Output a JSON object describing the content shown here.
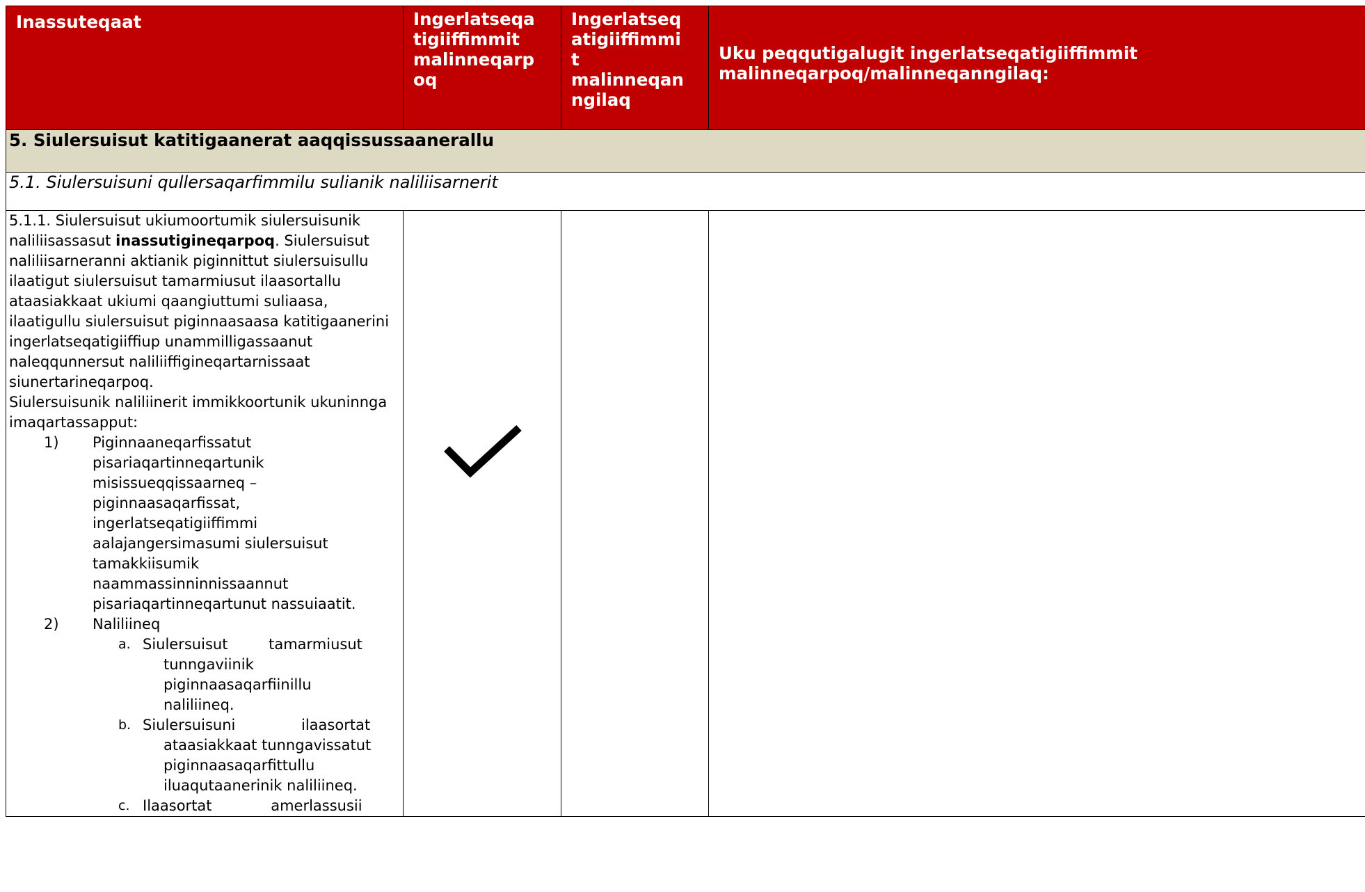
{
  "header": {
    "col1": "Inassuteqaat",
    "col2": "Ingerlatseqatigiiffimmit malinneqarpoq",
    "col2_lines": [
      "Ingerlatseqa",
      "tigiiffimmit",
      "malinneqarp",
      "oq"
    ],
    "col3_lines": [
      "Ingerlatseq",
      "atigiiffimmi",
      "t",
      "malinneqan",
      "ngilaq"
    ],
    "col4": "Uku peqqutigalugit ingerlatseqatigiiffimmit malinneqarpoq/malinneqanngilaq:"
  },
  "section": {
    "title": "5. Siulersuisut katitigaanerat aaqqissussaanerallu"
  },
  "subsection": {
    "title": "5.1. Siulersuisuni qullersaqarfimmilu sulianik naliliisarnerit"
  },
  "item": {
    "intro_before_bold": "5.1.1. Siulersuisut ukiumoortumik siulersuisunik naliliisassasut",
    "bold": "inassutigineqarpoq",
    "intro_after_bold": ". Siulersuisut naliliisarneranni aktianik piginnittut siulersuisullu ilaatigut siulersuisut tamarmiusut ilaasortallu ataasiakkaat ukiumi qaangiuttumi suliaasa, ilaatigullu siulersuisut piginnaasaasa katitigaanerini ingerlatseqatigiiffiup unammilligassaanut naleqqunnersut naliliiffigineqartarnissaat siunertarineqarpoq.",
    "para2": "Siulersuisunik naliliinerit immikkoortunik ukuninnga imaqartassapput:",
    "points": [
      {
        "num": "1)",
        "text": "Piginnaaneqarfissatut pisariaqartinneqartunik misissueqqissaarneq – piginnaasaqarfissat, ingerlatseqatigiiffimmi aalajangersimasumi siulersuisut tamakkiisumik naammassinninnissaannut pisariaqartinneqartunut nassuiaatit."
      },
      {
        "num": "2)",
        "text": "Naliliineq"
      }
    ],
    "subpoints": [
      {
        "letter": "a.",
        "first": "Siulersuisut tamarmiusut",
        "rest": "tunngaviinik piginnaasaqarfiinillu naliliineq."
      },
      {
        "letter": "b.",
        "first": "Siulersuisuni ilaasortat",
        "rest": "ataasiakkaat tunngavissatut piginnaasaqarfittullu iluaqutaanerinik naliliineq."
      },
      {
        "letter": "c.",
        "first": "Ilaasortat amerlassusii",
        "rest": ""
      }
    ],
    "followed": true,
    "not_followed": false,
    "explanation": ""
  },
  "icons": {
    "check": "checkmark-icon"
  }
}
